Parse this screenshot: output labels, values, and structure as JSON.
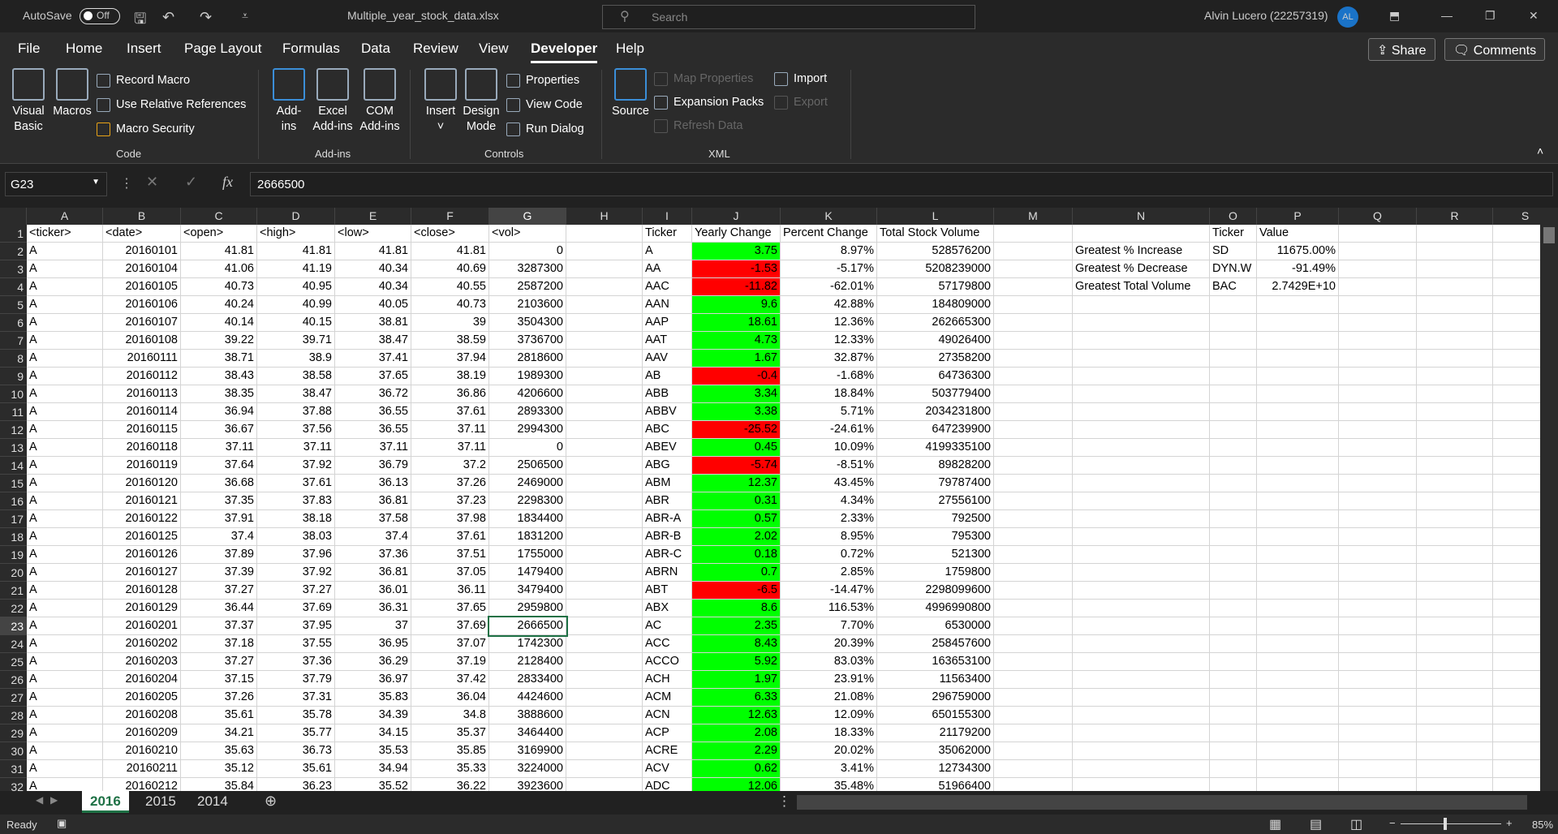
{
  "titlebar": {
    "autosave_label": "AutoSave",
    "autosave_state": "Off",
    "filename": "Multiple_year_stock_data.xlsx",
    "search_placeholder": "Search",
    "user": "Alvin Lucero (22257319)",
    "avatar_initials": "AL"
  },
  "tabs": [
    {
      "label": "File"
    },
    {
      "label": "Home"
    },
    {
      "label": "Insert"
    },
    {
      "label": "Page Layout"
    },
    {
      "label": "Formulas"
    },
    {
      "label": "Data"
    },
    {
      "label": "Review"
    },
    {
      "label": "View"
    },
    {
      "label": "Developer",
      "active": true
    },
    {
      "label": "Help"
    }
  ],
  "share_label": "Share",
  "comments_label": "Comments",
  "ribbon": {
    "code": {
      "group": "Code",
      "visual_basic": [
        "Visual",
        "Basic"
      ],
      "macros": "Macros",
      "record_macro": "Record Macro",
      "relative_refs": "Use Relative References",
      "macro_security": "Macro Security"
    },
    "addins": {
      "group": "Add-ins",
      "addins": [
        "Add-",
        "ins"
      ],
      "excel_addins": [
        "Excel",
        "Add-ins"
      ],
      "com_addins": [
        "COM",
        "Add-ins"
      ]
    },
    "controls": {
      "group": "Controls",
      "insert": "Insert",
      "design_mode": [
        "Design",
        "Mode"
      ],
      "properties": "Properties",
      "view_code": "View Code",
      "run_dialog": "Run Dialog"
    },
    "xml": {
      "group": "XML",
      "source": "Source",
      "map_properties": "Map Properties",
      "expansion_packs": "Expansion Packs",
      "refresh_data": "Refresh Data",
      "import": "Import",
      "export": "Export"
    }
  },
  "formula_bar": {
    "name_box": "G23",
    "formula": "2666500"
  },
  "colors": {
    "positive": "#00ff00",
    "negative": "#ff0000",
    "accent": "#1e7145"
  },
  "sheet": {
    "columns": [
      "A",
      "B",
      "C",
      "D",
      "E",
      "F",
      "G",
      "H",
      "I",
      "J",
      "K",
      "L",
      "M",
      "N",
      "O",
      "P",
      "Q",
      "R",
      "S"
    ],
    "selected": {
      "column": "G",
      "row": 23
    },
    "header_row": [
      "<ticker>",
      "<date>",
      "<open>",
      "<high>",
      "<low>",
      "<close>",
      "<vol>",
      "",
      "Ticker",
      "Yearly Change",
      "Percent Change",
      "Total Stock Volume",
      "",
      "",
      "Ticker",
      "Value"
    ],
    "raw_rows": [
      [
        "A",
        "20160101",
        "41.81",
        "41.81",
        "41.81",
        "41.81",
        "0"
      ],
      [
        "A",
        "20160104",
        "41.06",
        "41.19",
        "40.34",
        "40.69",
        "3287300"
      ],
      [
        "A",
        "20160105",
        "40.73",
        "40.95",
        "40.34",
        "40.55",
        "2587200"
      ],
      [
        "A",
        "20160106",
        "40.24",
        "40.99",
        "40.05",
        "40.73",
        "2103600"
      ],
      [
        "A",
        "20160107",
        "40.14",
        "40.15",
        "38.81",
        "39",
        "3504300"
      ],
      [
        "A",
        "20160108",
        "39.22",
        "39.71",
        "38.47",
        "38.59",
        "3736700"
      ],
      [
        "A",
        "20160111",
        "38.71",
        "38.9",
        "37.41",
        "37.94",
        "2818600"
      ],
      [
        "A",
        "20160112",
        "38.43",
        "38.58",
        "37.65",
        "38.19",
        "1989300"
      ],
      [
        "A",
        "20160113",
        "38.35",
        "38.47",
        "36.72",
        "36.86",
        "4206600"
      ],
      [
        "A",
        "20160114",
        "36.94",
        "37.88",
        "36.55",
        "37.61",
        "2893300"
      ],
      [
        "A",
        "20160115",
        "36.67",
        "37.56",
        "36.55",
        "37.11",
        "2994300"
      ],
      [
        "A",
        "20160118",
        "37.11",
        "37.11",
        "37.11",
        "37.11",
        "0"
      ],
      [
        "A",
        "20160119",
        "37.64",
        "37.92",
        "36.79",
        "37.2",
        "2506500"
      ],
      [
        "A",
        "20160120",
        "36.68",
        "37.61",
        "36.13",
        "37.26",
        "2469000"
      ],
      [
        "A",
        "20160121",
        "37.35",
        "37.83",
        "36.81",
        "37.23",
        "2298300"
      ],
      [
        "A",
        "20160122",
        "37.91",
        "38.18",
        "37.58",
        "37.98",
        "1834400"
      ],
      [
        "A",
        "20160125",
        "37.4",
        "38.03",
        "37.4",
        "37.61",
        "1831200"
      ],
      [
        "A",
        "20160126",
        "37.89",
        "37.96",
        "37.36",
        "37.51",
        "1755000"
      ],
      [
        "A",
        "20160127",
        "37.39",
        "37.92",
        "36.81",
        "37.05",
        "1479400"
      ],
      [
        "A",
        "20160128",
        "37.27",
        "37.27",
        "36.01",
        "36.11",
        "3479400"
      ],
      [
        "A",
        "20160129",
        "36.44",
        "37.69",
        "36.31",
        "37.65",
        "2959800"
      ],
      [
        "A",
        "20160201",
        "37.37",
        "37.95",
        "37",
        "37.69",
        "2666500"
      ],
      [
        "A",
        "20160202",
        "37.18",
        "37.55",
        "36.95",
        "37.07",
        "1742300"
      ],
      [
        "A",
        "20160203",
        "37.27",
        "37.36",
        "36.29",
        "37.19",
        "2128400"
      ],
      [
        "A",
        "20160204",
        "37.15",
        "37.79",
        "36.97",
        "37.42",
        "2833400"
      ],
      [
        "A",
        "20160205",
        "37.26",
        "37.31",
        "35.83",
        "36.04",
        "4424600"
      ],
      [
        "A",
        "20160208",
        "35.61",
        "35.78",
        "34.39",
        "34.8",
        "3888600"
      ],
      [
        "A",
        "20160209",
        "34.21",
        "35.77",
        "34.15",
        "35.37",
        "3464400"
      ],
      [
        "A",
        "20160210",
        "35.63",
        "36.73",
        "35.53",
        "35.85",
        "3169900"
      ],
      [
        "A",
        "20160211",
        "35.12",
        "35.61",
        "34.94",
        "35.33",
        "3224000"
      ],
      [
        "A",
        "20160212",
        "35.84",
        "36.23",
        "35.52",
        "36.22",
        "3923600"
      ]
    ],
    "summary_rows": [
      [
        "A",
        "3.75",
        "8.97%",
        "528576200"
      ],
      [
        "AA",
        "-1.53",
        "-5.17%",
        "5208239000"
      ],
      [
        "AAC",
        "-11.82",
        "-62.01%",
        "57179800"
      ],
      [
        "AAN",
        "9.6",
        "42.88%",
        "184809000"
      ],
      [
        "AAP",
        "18.61",
        "12.36%",
        "262665300"
      ],
      [
        "AAT",
        "4.73",
        "12.33%",
        "49026400"
      ],
      [
        "AAV",
        "1.67",
        "32.87%",
        "27358200"
      ],
      [
        "AB",
        "-0.4",
        "-1.68%",
        "64736300"
      ],
      [
        "ABB",
        "3.34",
        "18.84%",
        "503779400"
      ],
      [
        "ABBV",
        "3.38",
        "5.71%",
        "2034231800"
      ],
      [
        "ABC",
        "-25.52",
        "-24.61%",
        "647239900"
      ],
      [
        "ABEV",
        "0.45",
        "10.09%",
        "4199335100"
      ],
      [
        "ABG",
        "-5.74",
        "-8.51%",
        "89828200"
      ],
      [
        "ABM",
        "12.37",
        "43.45%",
        "79787400"
      ],
      [
        "ABR",
        "0.31",
        "4.34%",
        "27556100"
      ],
      [
        "ABR-A",
        "0.57",
        "2.33%",
        "792500"
      ],
      [
        "ABR-B",
        "2.02",
        "8.95%",
        "795300"
      ],
      [
        "ABR-C",
        "0.18",
        "0.72%",
        "521300"
      ],
      [
        "ABRN",
        "0.7",
        "2.85%",
        "1759800"
      ],
      [
        "ABT",
        "-6.5",
        "-14.47%",
        "2298099600"
      ],
      [
        "ABX",
        "8.6",
        "116.53%",
        "4996990800"
      ],
      [
        "AC",
        "2.35",
        "7.70%",
        "6530000"
      ],
      [
        "ACC",
        "8.43",
        "20.39%",
        "258457600"
      ],
      [
        "ACCO",
        "5.92",
        "83.03%",
        "163653100"
      ],
      [
        "ACH",
        "1.97",
        "23.91%",
        "11563400"
      ],
      [
        "ACM",
        "6.33",
        "21.08%",
        "296759000"
      ],
      [
        "ACN",
        "12.63",
        "12.09%",
        "650155300"
      ],
      [
        "ACP",
        "2.08",
        "18.33%",
        "21179200"
      ],
      [
        "ACRE",
        "2.29",
        "20.02%",
        "35062000"
      ],
      [
        "ACV",
        "0.62",
        "3.41%",
        "12734300"
      ],
      [
        "ADC",
        "12.06",
        "35.48%",
        "51966400"
      ]
    ],
    "greatest": [
      [
        "Greatest % Increase",
        "SD",
        "11675.00%"
      ],
      [
        "Greatest % Decrease",
        "DYN.W",
        "-91.49%"
      ],
      [
        "Greatest Total Volume",
        "BAC",
        "2.7429E+10"
      ]
    ]
  },
  "sheet_tabs": [
    {
      "label": "2016",
      "active": true
    },
    {
      "label": "2015"
    },
    {
      "label": "2014"
    }
  ],
  "status": {
    "ready": "Ready",
    "zoom": "85%",
    "zoom_level": 0.85
  }
}
